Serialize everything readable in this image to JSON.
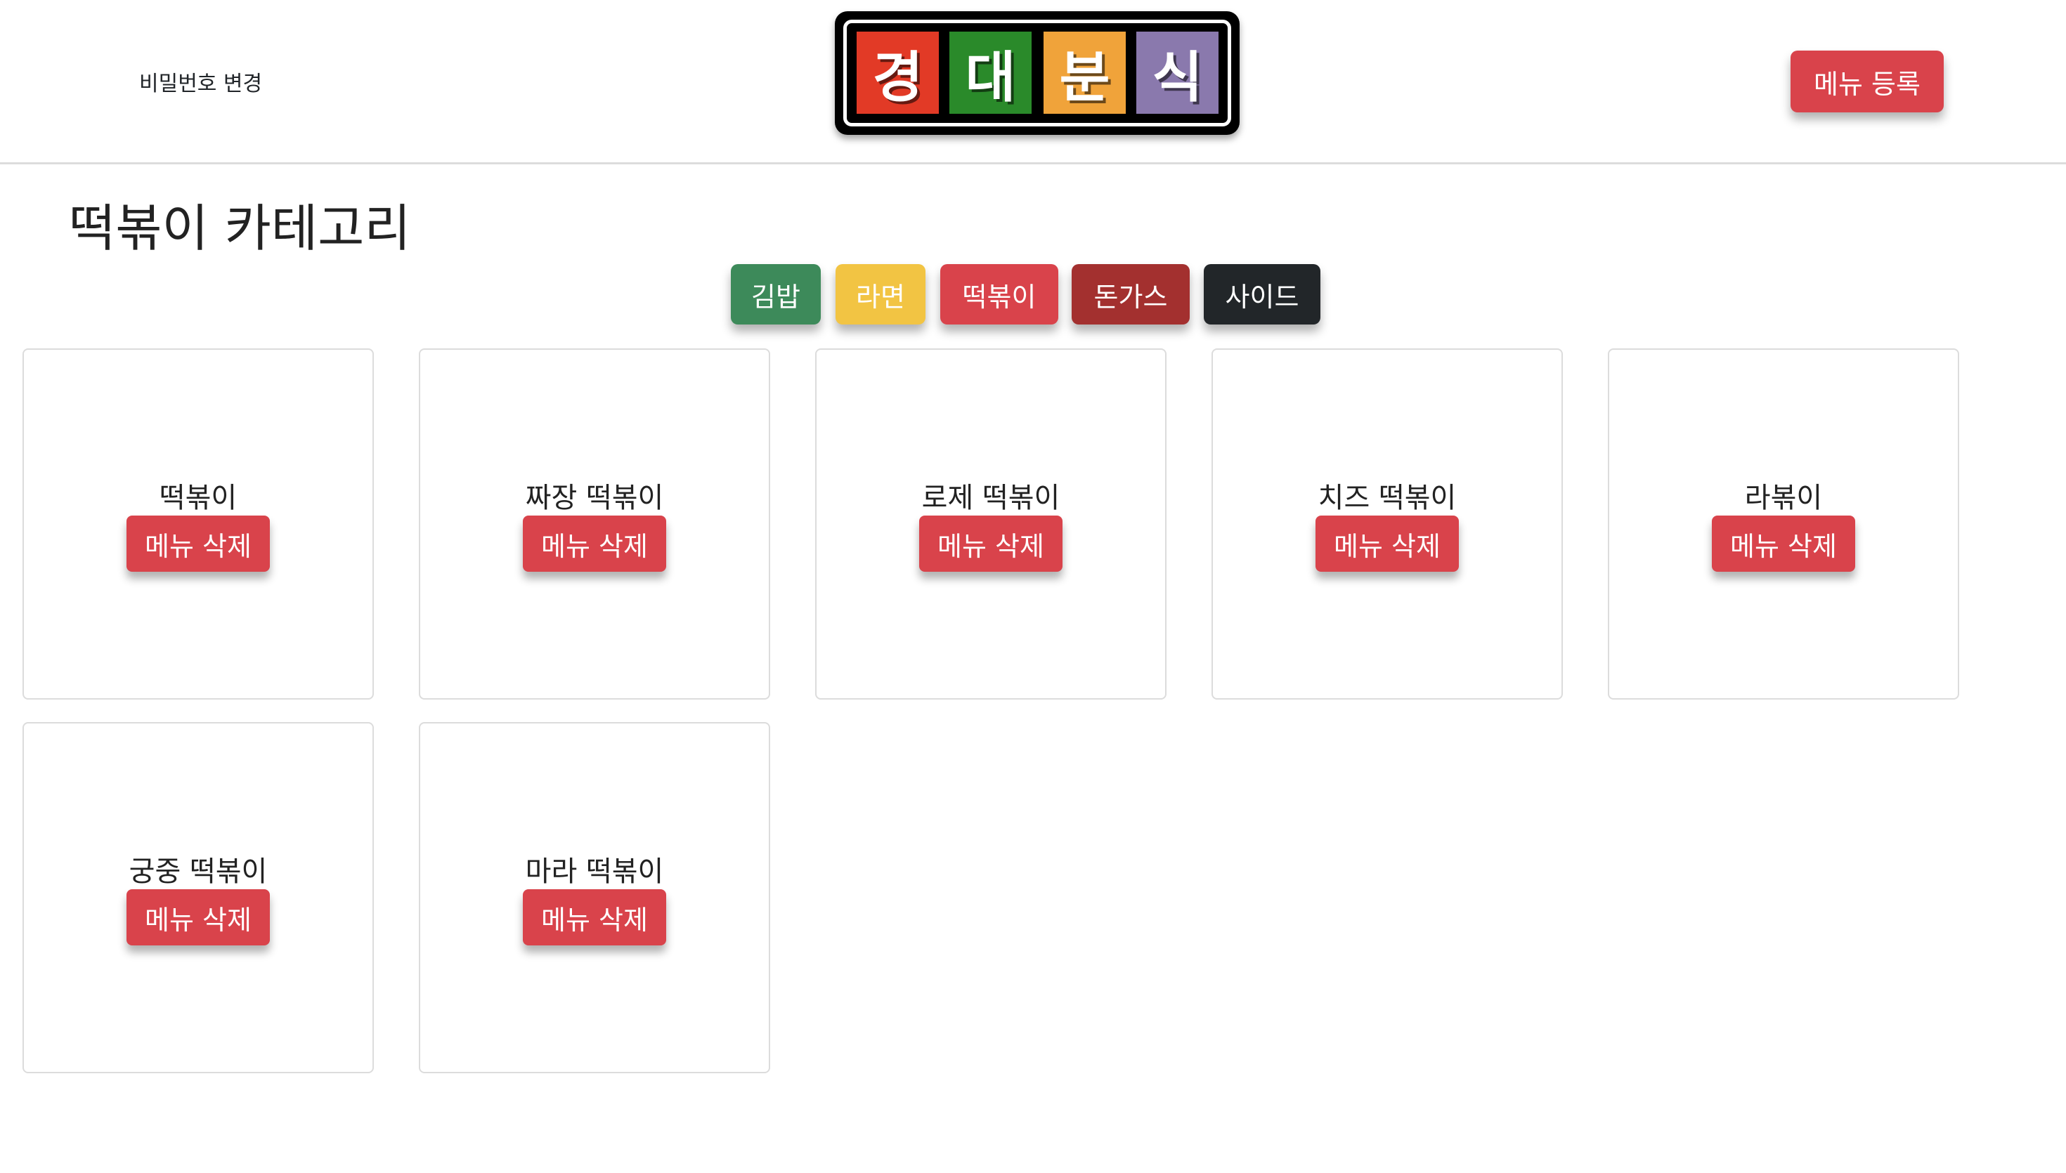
{
  "header": {
    "change_password_label": "비밀번호 변경",
    "logo_chars": [
      "경",
      "대",
      "분",
      "식"
    ],
    "logo_colors": [
      "#e23a26",
      "#2a8a2a",
      "#f0a33a",
      "#8a79ad"
    ],
    "register_label": "메뉴 등록"
  },
  "page": {
    "title": "떡볶이 카테고리"
  },
  "categories": [
    {
      "label": "김밥",
      "color": "#3d8a5a"
    },
    {
      "label": "라면",
      "color": "#f2c443"
    },
    {
      "label": "떡볶이",
      "color": "#d9434b"
    },
    {
      "label": "돈가스",
      "color": "#a3302f"
    },
    {
      "label": "사이드",
      "color": "#222629"
    }
  ],
  "menu_items": [
    {
      "name": "떡볶이",
      "delete_label": "메뉴 삭제"
    },
    {
      "name": "짜장 떡볶이",
      "delete_label": "메뉴 삭제"
    },
    {
      "name": "로제 떡볶이",
      "delete_label": "메뉴 삭제"
    },
    {
      "name": "치즈 떡볶이",
      "delete_label": "메뉴 삭제"
    },
    {
      "name": "라볶이",
      "delete_label": "메뉴 삭제"
    },
    {
      "name": "궁중 떡볶이",
      "delete_label": "메뉴 삭제"
    },
    {
      "name": "마라 떡볶이",
      "delete_label": "메뉴 삭제"
    }
  ]
}
